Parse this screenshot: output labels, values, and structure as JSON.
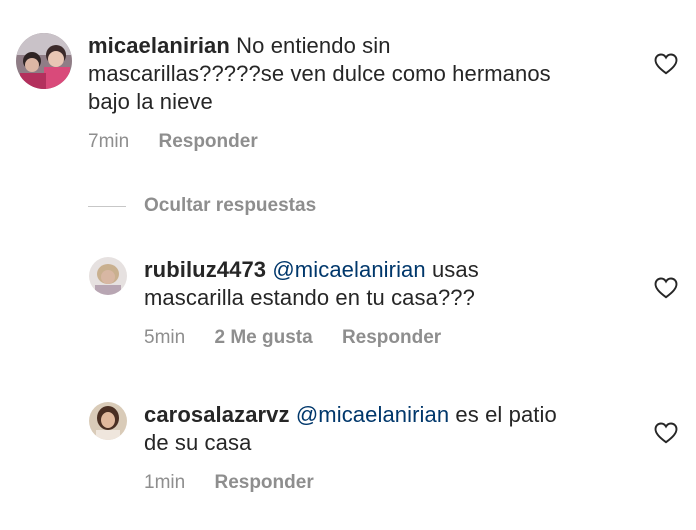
{
  "comments": [
    {
      "username": "micaelanirian",
      "text_line1": "No entiendo sin",
      "text_line2": "mascarillas?????se ven dulce como hermanos",
      "text_line3": "bajo la nieve",
      "time": "7min",
      "reply_label": "Responder"
    }
  ],
  "thread": {
    "hide_replies_label": "Ocultar respuestas"
  },
  "replies": [
    {
      "username": "rubiluz4473",
      "mention": "@micaelanirian",
      "text_line1": "usas",
      "text_line2": "mascarilla estando en tu casa???",
      "time": "5min",
      "likes_label": "2 Me gusta",
      "reply_label": "Responder"
    },
    {
      "username": "carosalazarvz",
      "mention": "@micaelanirian",
      "text_line1": "es el patio",
      "text_line2": "de su casa",
      "time": "1min",
      "reply_label": "Responder"
    }
  ],
  "icons": {
    "like": "heart-outline-icon",
    "avatar": "user-avatar"
  },
  "colors": {
    "text": "#262626",
    "secondary": "#8e8e8e",
    "mention": "#00376b",
    "divider": "#c7c7c7"
  }
}
